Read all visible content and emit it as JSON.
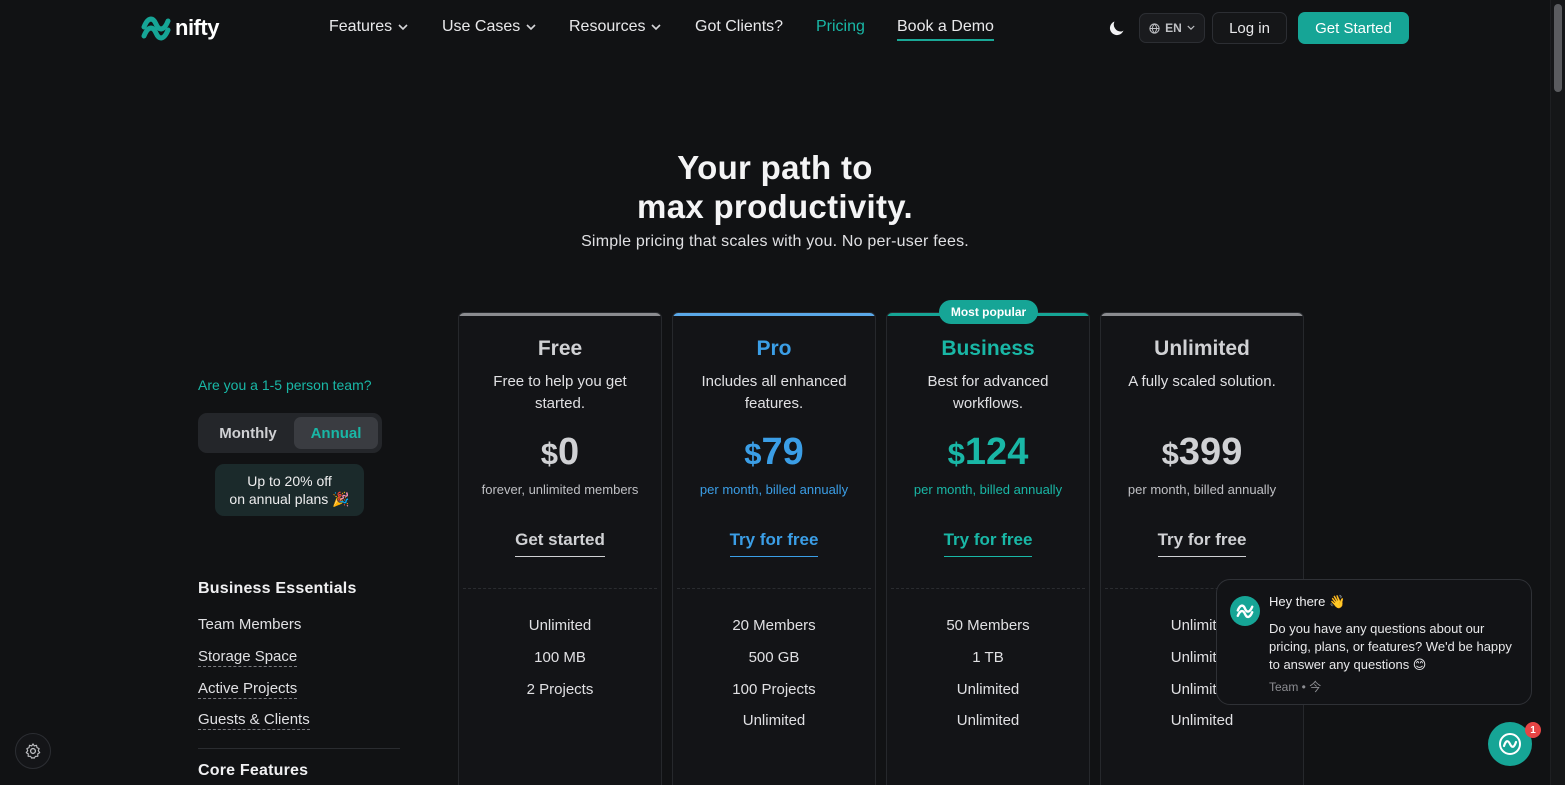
{
  "brand": {
    "name": "nifty",
    "accent": "#16a596"
  },
  "nav": {
    "features": "Features",
    "use_cases": "Use Cases",
    "resources": "Resources",
    "got_clients": "Got Clients?",
    "pricing": "Pricing",
    "book_demo": "Book a Demo",
    "chevron": "⌄",
    "theme_icon": "moon-icon",
    "lang": "EN",
    "login": "Log in",
    "get_started": "Get Started"
  },
  "hero": {
    "title_line1": "Your path to",
    "title_line2": "max productivity.",
    "subtitle": "Simple pricing that scales with you. No per-user fees."
  },
  "billing": {
    "question": "Are you a 1-5 person team?",
    "monthly": "Monthly",
    "annual": "Annual",
    "selected": "Annual",
    "discount_line1": "Up to 20% off",
    "discount_line2": "on annual plans 🎉"
  },
  "sections": {
    "business_essentials": "Business Essentials",
    "core_features": "Core Features"
  },
  "features": [
    {
      "label": "Team Members",
      "dotted": false
    },
    {
      "label": "Storage Space",
      "dotted": true
    },
    {
      "label": "Active Projects",
      "dotted": true
    },
    {
      "label": "Guests & Clients",
      "dotted": true
    }
  ],
  "badge": "Most popular",
  "plans": [
    {
      "name": "Free",
      "color": "#d0d1d4",
      "top_color": "#8b8c90",
      "desc": "Free to help you get started.",
      "currency": "$",
      "price": "0",
      "period": "forever, unlimited members",
      "period_color": "#bfc0c4",
      "cta": "Get started",
      "features": [
        "Unlimited",
        "100 MB",
        "2 Projects",
        ""
      ]
    },
    {
      "name": "Pro",
      "color": "#3b9ee6",
      "top_color": "#5aa8e8",
      "desc": "Includes all enhanced features.",
      "currency": "$",
      "price": "79",
      "period": "per month, billed annually",
      "period_color": "#3b9ee6",
      "cta": "Try for free",
      "features": [
        "20 Members",
        "500 GB",
        "100 Projects",
        "Unlimited"
      ]
    },
    {
      "name": "Business",
      "color": "#19b7a6",
      "top_color": "#16a596",
      "desc": "Best for advanced workflows.",
      "currency": "$",
      "price": "124",
      "period": "per month, billed annually",
      "period_color": "#19b7a6",
      "cta": "Try for free",
      "features": [
        "50 Members",
        "1 TB",
        "Unlimited",
        "Unlimited"
      ]
    },
    {
      "name": "Unlimited",
      "color": "#d0d1d4",
      "top_color": "#8b8c90",
      "desc": "A fully scaled solution.",
      "currency": "$",
      "price": "399",
      "period": "per month, billed annually",
      "period_color": "#bfc0c4",
      "cta": "Try for free",
      "features": [
        "Unlimited",
        "Unlimited",
        "Unlimited",
        "Unlimited"
      ]
    }
  ],
  "chat": {
    "greeting": "Hey there 👋",
    "message": "Do you have any questions about our pricing, plans, or features? We'd be happy to answer any questions 😊",
    "meta": "Team • 今",
    "unread": "1"
  }
}
